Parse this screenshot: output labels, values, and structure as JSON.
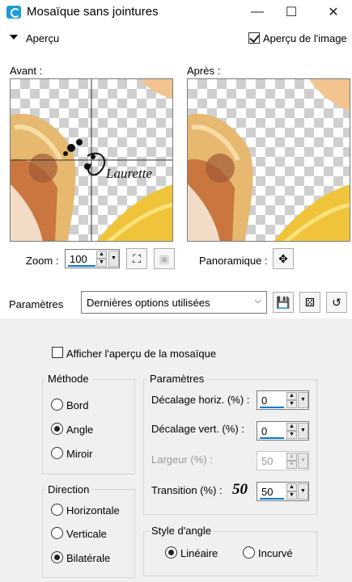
{
  "window": {
    "title": "Mosaïque sans jointures",
    "minimize": "—",
    "maximize": "☐",
    "close": "✕"
  },
  "preview_section": {
    "label": "Aperçu",
    "image_preview_label": "Aperçu de l'image",
    "image_preview_checked": true,
    "before_label": "Avant :",
    "after_label": "Après :",
    "watermark": "Laurette",
    "zoom_label": "Zoom :",
    "zoom_value": "100",
    "pan_label": "Panoramique :"
  },
  "presets": {
    "label": "Paramètres",
    "selected": "Dernières options utilisées"
  },
  "options": {
    "show_tile_preview_label": "Afficher l'aperçu de la mosaïque",
    "show_tile_preview_checked": false,
    "method": {
      "title": "Méthode",
      "items": [
        "Bord",
        "Angle",
        "Miroir"
      ],
      "selected": "Angle"
    },
    "direction": {
      "title": "Direction",
      "items": [
        "Horizontale",
        "Verticale",
        "Bilatérale"
      ],
      "selected": "Bilatérale"
    },
    "parameters": {
      "title": "Paramètres",
      "h_offset_label": "Décalage horiz. (%) :",
      "h_offset_value": "0",
      "v_offset_label": "Décalage vert. (%) :",
      "v_offset_value": "0",
      "width_label": "Largeur (%) :",
      "width_value": "50",
      "transition_label": "Transition (%) :",
      "transition_value": "50",
      "transition_annotation": "50"
    },
    "corner_style": {
      "title": "Style d'angle",
      "items": [
        "Linéaire",
        "Incurvé"
      ],
      "selected": "Linéaire"
    }
  },
  "colors": {
    "accent": "#0078d7",
    "hair_gold": "#e8b960",
    "fabric_yellow": "#f0c43a"
  }
}
